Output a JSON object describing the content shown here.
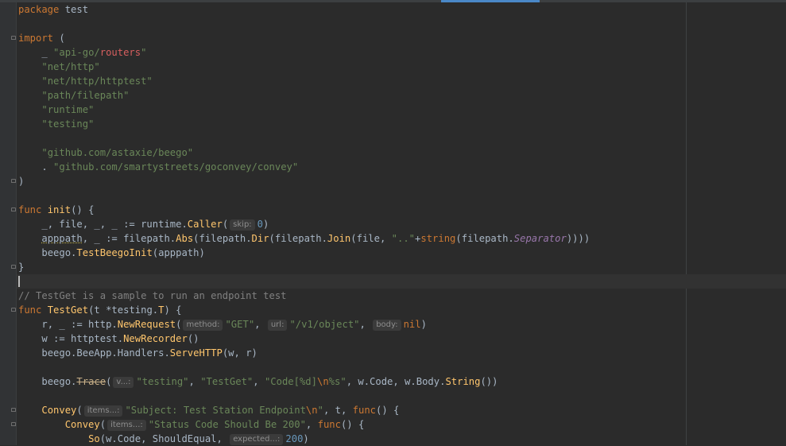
{
  "editor": {
    "language": "Go",
    "package_kw": "package",
    "package_name": "test",
    "import_kw": "import",
    "import_open": "(",
    "import_close": ")",
    "imports": [
      {
        "alias": "_",
        "pre": "\"api-go/",
        "hl": "routers",
        "post": "\""
      },
      {
        "path": "\"net/http\""
      },
      {
        "path": "\"net/http/httptest\""
      },
      {
        "path": "\"path/filepath\""
      },
      {
        "path": "\"runtime\""
      },
      {
        "path": "\"testing\""
      },
      {
        "path": "\"github.com/astaxie/beego\""
      },
      {
        "alias": ".",
        "path": "\"github.com/smartystreets/goconvey/convey\""
      }
    ],
    "init_func": {
      "kw": "func",
      "name": "init",
      "sig": "() {",
      "line1_pre": "_, file, _, _ := runtime.",
      "line1_call": "Caller",
      "line1_open": "(",
      "line1_hint": "skip:",
      "line1_arg": "0",
      "line1_close": ")",
      "line2_var": "apppath",
      "line2_a": ", _ := filepath.",
      "line2_abs": "Abs",
      "line2_b": "(filepath.",
      "line2_dir": "Dir",
      "line2_c": "(filepath.",
      "line2_join": "Join",
      "line2_d": "(file, ",
      "line2_str": "\"..\"",
      "line2_e": "+",
      "line2_string": "string",
      "line2_f": "(filepath.",
      "line2_sep": "Separator",
      "line2_g": "))))",
      "line3_a": "beego.",
      "line3_fn": "TestBeegoInit",
      "line3_b": "(apppath)",
      "close": "}"
    },
    "comment": "// TestGet is a sample to run an endpoint test",
    "testget_func": {
      "kw": "func",
      "name": "TestGet",
      "sig_a": "(t *testing.",
      "sig_t": "T",
      "sig_b": ") {",
      "l1_a": "r, _ := http.",
      "l1_fn": "NewRequest",
      "l1_open": "(",
      "l1_hint1": "method:",
      "l1_arg1": "\"GET\"",
      "l1_comma1": ",",
      "l1_hint2": "url:",
      "l1_arg2": "\"/v1/object\"",
      "l1_comma2": ",",
      "l1_hint3": "body:",
      "l1_arg3": "nil",
      "l1_close": ")",
      "l2_a": "w := httptest.",
      "l2_fn": "NewRecorder",
      "l2_b": "()",
      "l3_a": "beego.",
      "l3_b": "BeeApp",
      "l3_c": ".Handlers.",
      "l3_fn": "ServeHTTP",
      "l3_d": "(w, r)",
      "l4_a": "beego.",
      "l4_fn": "Trace",
      "l4_open": "(",
      "l4_hint": "v...:",
      "l4_s1": "\"testing\"",
      "l4_comma1": ",",
      "l4_s2": "\"TestGet\"",
      "l4_comma2": ",",
      "l4_s3a": "\"Code[%d]",
      "l4_esc": "\\n",
      "l4_s3b": "%s\"",
      "l4_rest_a": ", w.Code, w.Body.",
      "l4_fn2": "String",
      "l4_rest_b": "())",
      "c1_fn": "Convey",
      "c1_open": "(",
      "c1_hint": "items...:",
      "c1_sa": "\"Subject: Test Station Endpoint",
      "c1_esc": "\\n",
      "c1_sb": "\"",
      "c1_rest": ", t, ",
      "c1_func": "func",
      "c1_end": "() {",
      "c2_fn": "Convey",
      "c2_open": "(",
      "c2_hint": "items...:",
      "c2_str": "\"Status Code Should Be 200\"",
      "c2_comma": ",",
      "c2_func": "func",
      "c2_end": "() {",
      "c3_fn": "So",
      "c3_a": "(w.Code, ShouldEqual,",
      "c3_hint": "expected...:",
      "c3_num": "200",
      "c3_close": ")"
    }
  }
}
